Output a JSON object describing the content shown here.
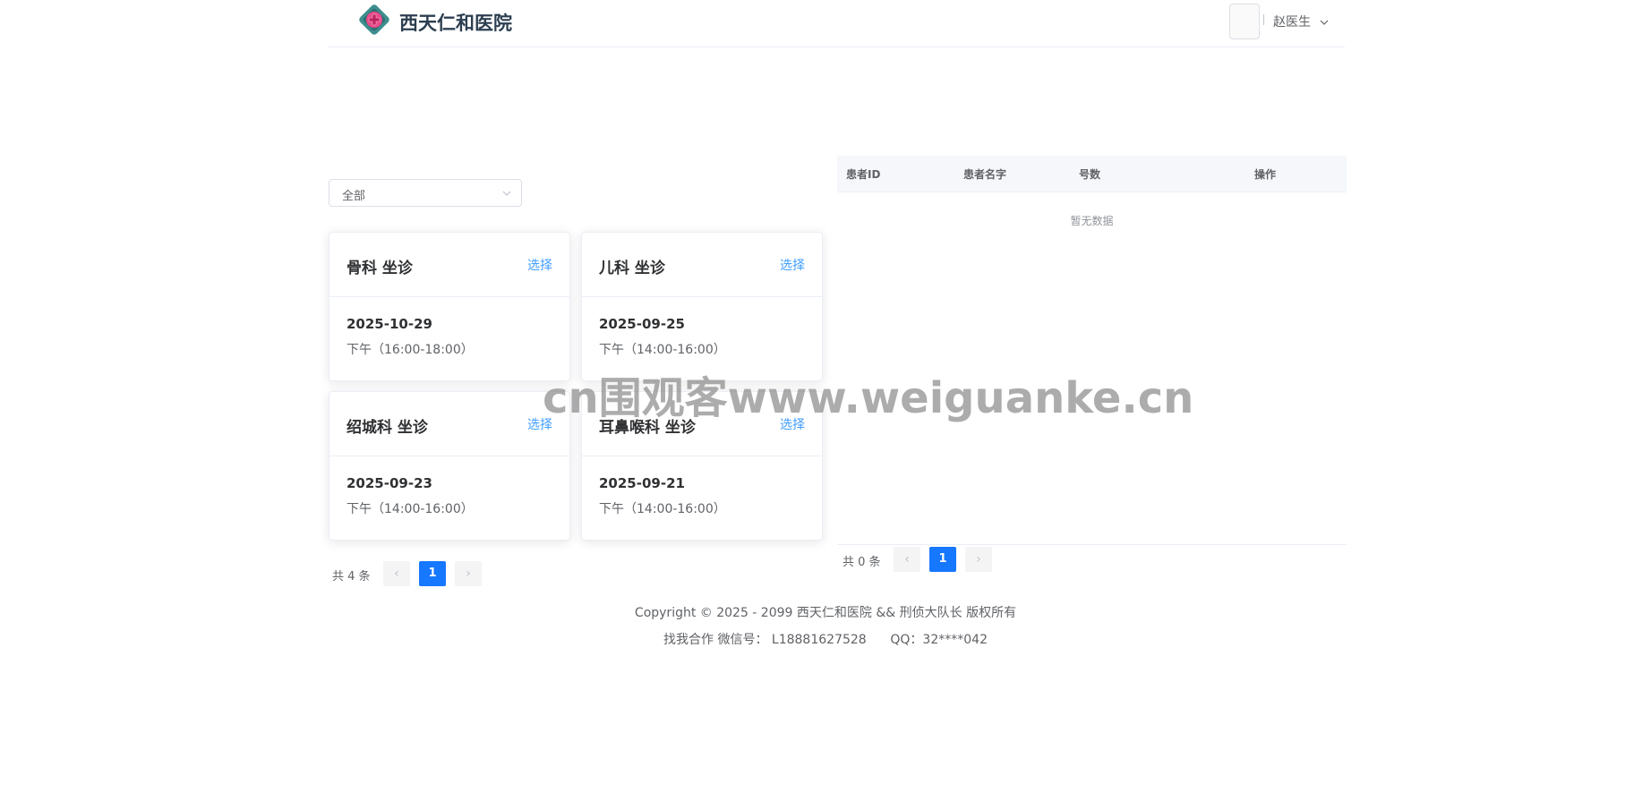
{
  "header": {
    "title": "西天仁和医院",
    "user_name": "赵医生"
  },
  "filter": {
    "selected": "全部"
  },
  "cards": [
    {
      "title": "骨科 坐诊",
      "action": "选择",
      "date": "2025-10-29",
      "time": "下午（16:00-18:00）"
    },
    {
      "title": "儿科 坐诊",
      "action": "选择",
      "date": "2025-09-25",
      "time": "下午（14:00-16:00）"
    },
    {
      "title": "绍城科 坐诊",
      "action": "选择",
      "date": "2025-09-23",
      "time": "下午（14:00-16:00）"
    },
    {
      "title": "耳鼻喉科 坐诊",
      "action": "选择",
      "date": "2025-09-21",
      "time": "下午（14:00-16:00）"
    }
  ],
  "cards_pager": {
    "total": "共 4 条",
    "prev": "‹",
    "page": "1",
    "next": "›"
  },
  "table": {
    "columns": [
      "患者ID",
      "患者名字",
      "号数",
      "操作"
    ],
    "empty_text": "暂无数据"
  },
  "table_pager": {
    "total": "共 0 条",
    "prev": "‹",
    "page": "1",
    "next": "›"
  },
  "footer": {
    "copyright": "Copyright © 2025 - 2099 西天仁和医院 && 刑侦大队长 版权所有",
    "contact": "找我合作 微信号： L18881627528      QQ：32****042"
  },
  "watermark": "cn围观客www.weiguanke.cn",
  "colors": {
    "accent": "#409eff",
    "page_active": "#1677ff",
    "logo_diamond": "#3e8e8e",
    "logo_cross": "#e84a8a"
  }
}
